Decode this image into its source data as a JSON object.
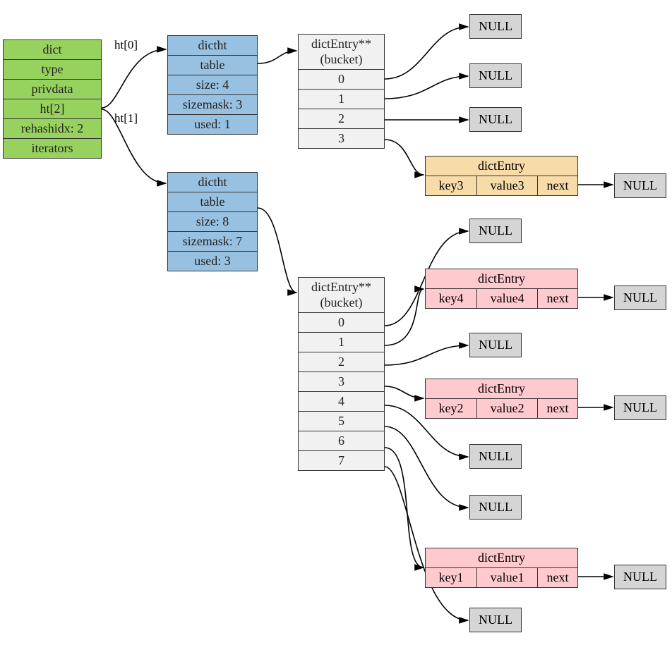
{
  "dict": {
    "title": "dict",
    "fields": [
      "type",
      "privdata",
      "ht[2]",
      "rehashidx: 2",
      "iterators"
    ]
  },
  "edge_labels": {
    "ht0": "ht[0]",
    "ht1": "ht[1]"
  },
  "dictht0": {
    "title": "dictht",
    "rows": [
      "table",
      "size: 4",
      "sizemask: 3",
      "used: 1"
    ]
  },
  "dictht1": {
    "title": "dictht",
    "rows": [
      "table",
      "size: 8",
      "sizemask: 7",
      "used: 3"
    ]
  },
  "bucket0": {
    "title_l1": "dictEntry**",
    "title_l2": "(bucket)",
    "slots": [
      "0",
      "1",
      "2",
      "3"
    ]
  },
  "bucket1": {
    "title_l1": "dictEntry**",
    "title_l2": "(bucket)",
    "slots": [
      "0",
      "1",
      "2",
      "3",
      "4",
      "5",
      "6",
      "7"
    ]
  },
  "entryY": {
    "title": "dictEntry",
    "key": "key3",
    "value": "value3",
    "next": "next"
  },
  "entryP1": {
    "title": "dictEntry",
    "key": "key4",
    "value": "value4",
    "next": "next"
  },
  "entryP2": {
    "title": "dictEntry",
    "key": "key2",
    "value": "value2",
    "next": "next"
  },
  "entryP3": {
    "title": "dictEntry",
    "key": "key1",
    "value": "value1",
    "next": "next"
  },
  "null_text": "NULL"
}
